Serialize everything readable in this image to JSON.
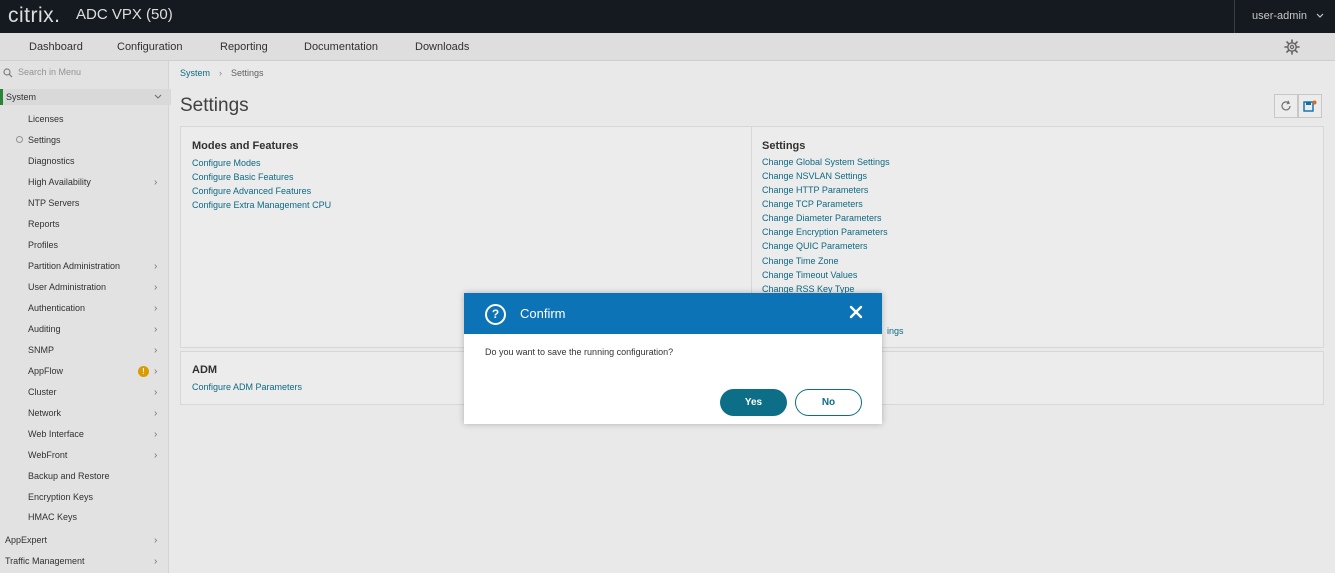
{
  "header": {
    "logo": "citrix.",
    "product": "ADC VPX (50)",
    "user": "user-admin"
  },
  "nav": {
    "items": [
      "Dashboard",
      "Configuration",
      "Reporting",
      "Documentation",
      "Downloads"
    ]
  },
  "sidebar": {
    "search_placeholder": "Search in Menu",
    "section_system": "System",
    "items": [
      "Licenses",
      "Settings",
      "Diagnostics",
      "High Availability",
      "NTP Servers",
      "Reports",
      "Profiles",
      "Partition Administration",
      "User Administration",
      "Authentication",
      "Auditing",
      "SNMP",
      "AppFlow",
      "Cluster",
      "Network",
      "Web Interface",
      "WebFront",
      "Backup and Restore",
      "Encryption Keys",
      "HMAC Keys"
    ],
    "warning_badge": "!",
    "section_appexpert": "AppExpert",
    "section_traffic": "Traffic Management"
  },
  "breadcrumb": {
    "root": "System",
    "current": "Settings"
  },
  "page": {
    "title": "Settings"
  },
  "panels": {
    "modes": {
      "title": "Modes and Features",
      "links": [
        "Configure Modes",
        "Configure Basic Features",
        "Configure Advanced Features",
        "Configure Extra Management CPU"
      ]
    },
    "settings": {
      "title": "Settings",
      "links": [
        "Change Global System Settings",
        "Change NSVLAN Settings",
        "Change HTTP Parameters",
        "Change TCP Parameters",
        "Change Diameter Parameters",
        "Change Encryption Parameters",
        "Change QUIC Parameters",
        "Change Time Zone",
        "Change Timeout Values",
        "Change RSS Key Type"
      ],
      "partial_link": "ings"
    },
    "adm": {
      "title": "ADM",
      "links": [
        "Configure ADM Parameters"
      ]
    }
  },
  "dialog": {
    "title": "Confirm",
    "icon": "question-icon",
    "message": "Do you want to save the running configuration?",
    "yes_label": "Yes",
    "no_label": "No"
  },
  "colors": {
    "header_bg": "#161c22",
    "dialog_header": "#0c74b6",
    "primary_button": "#0d6e88",
    "link": "#0f6e8a"
  }
}
